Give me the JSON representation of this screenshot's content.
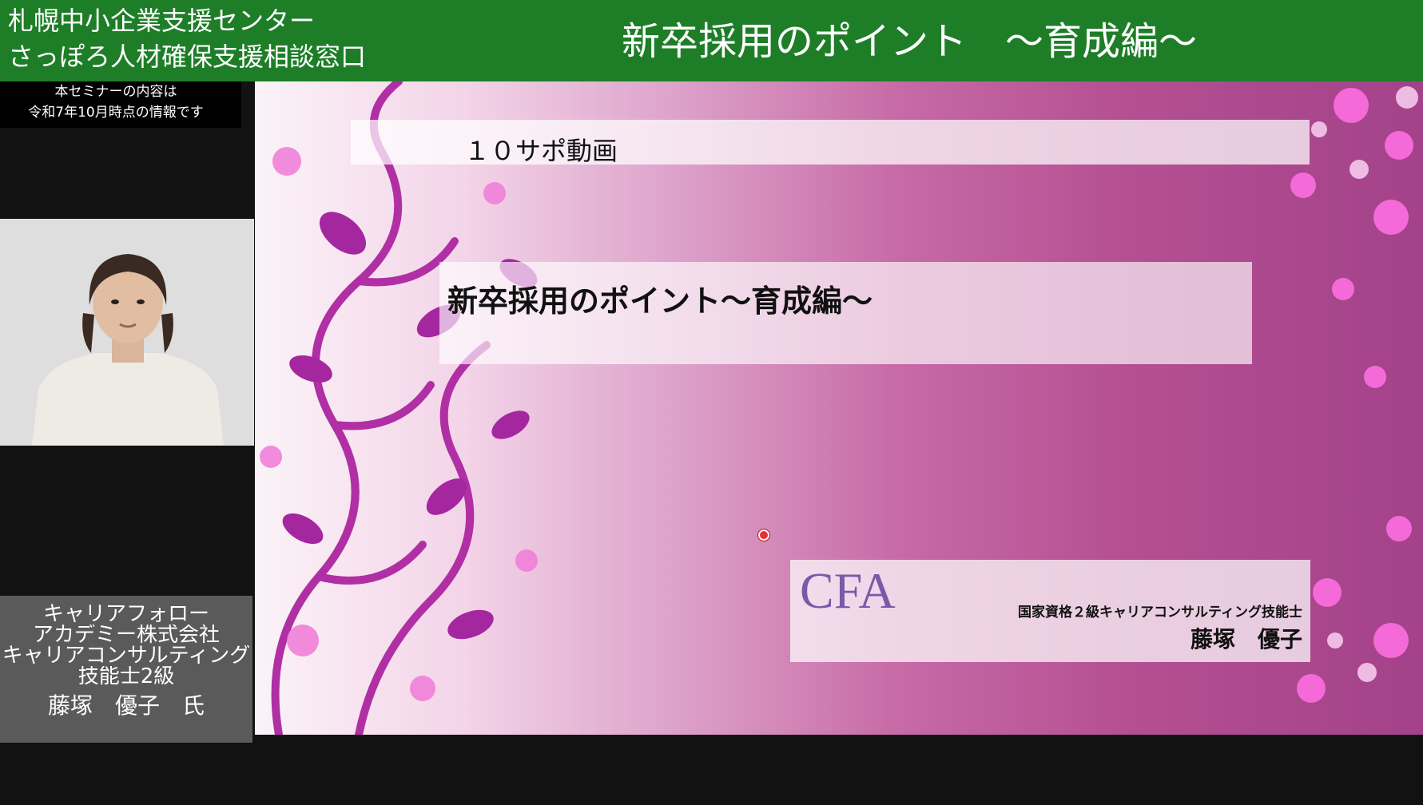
{
  "header": {
    "org_line1": "札幌中小企業支援センター",
    "org_line2": "さっぽろ人材確保支援相談窓口",
    "title": "新卒採用のポイント　～育成編～",
    "bg_color": "#1e7e28"
  },
  "notice": {
    "line1": "本セミナーの内容は",
    "line2": "令和7年10月時点の情報です"
  },
  "speaker_box": {
    "line1": "キャリアフォロー",
    "line2": "アカデミー株式会社",
    "line3": "キャリアコンサルティング",
    "line4": "技能士2級",
    "name": "藤塚　優子　氏"
  },
  "slide": {
    "series_label": "１０サポ動画",
    "title": "新卒採用のポイント～育成編～",
    "logo_text": "CFA",
    "qualification": "国家資格２級キャリアコンサルティング技能士",
    "presenter_name": "藤塚　優子"
  }
}
